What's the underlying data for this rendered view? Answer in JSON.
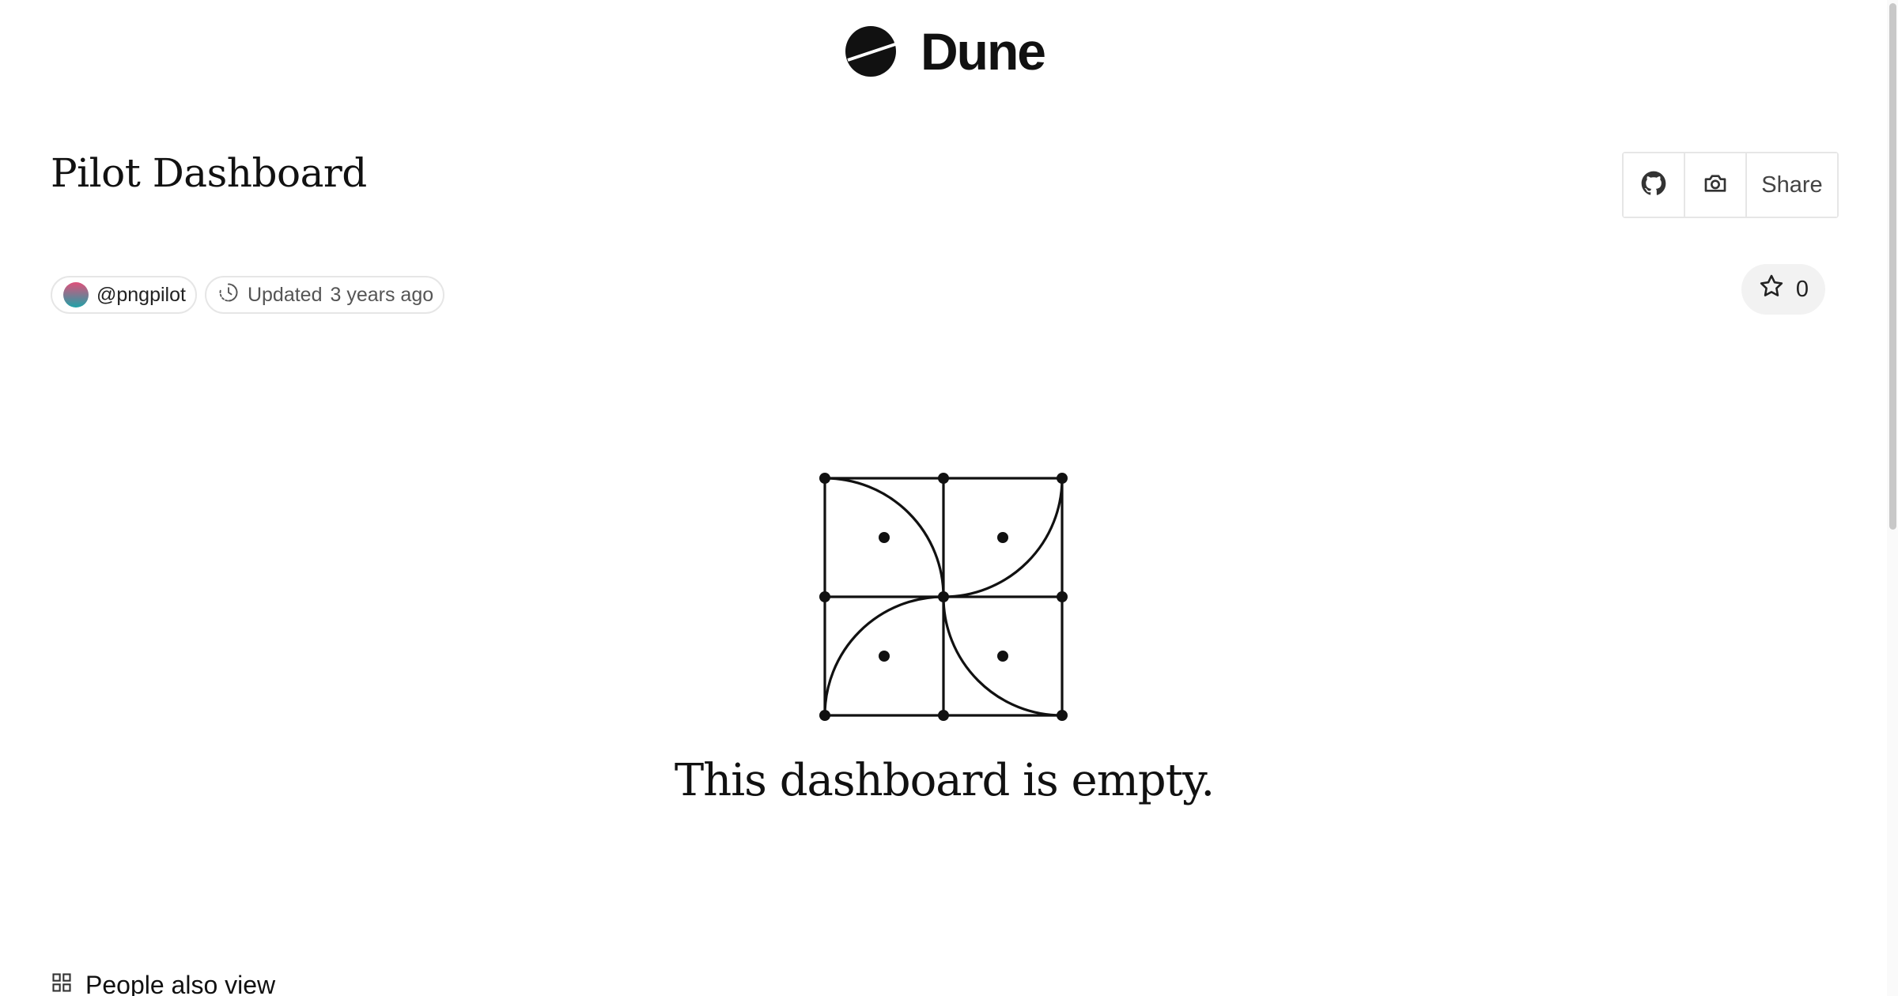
{
  "header": {
    "brand_name": "Dune",
    "logo_icon": "dune-logo-icon"
  },
  "dashboard": {
    "title": "Pilot Dashboard",
    "owner": "@pngpilot",
    "updated_label": "Updated",
    "updated_time": "3 years ago",
    "star_count": "0"
  },
  "actions": {
    "github_icon": "github-icon",
    "screenshot_icon": "camera-icon",
    "share_label": "Share"
  },
  "empty_state": {
    "message": "This dashboard is empty.",
    "illustration_icon": "empty-grid-illustration"
  },
  "related": {
    "heading": "People also view",
    "icon": "grid-icon"
  },
  "colors": {
    "text": "#111111",
    "border": "#e6e6e6",
    "star_bg": "#f2f2f2",
    "avatar_gradient_start": "#e0507a",
    "avatar_gradient_end": "#1fa2a8"
  }
}
